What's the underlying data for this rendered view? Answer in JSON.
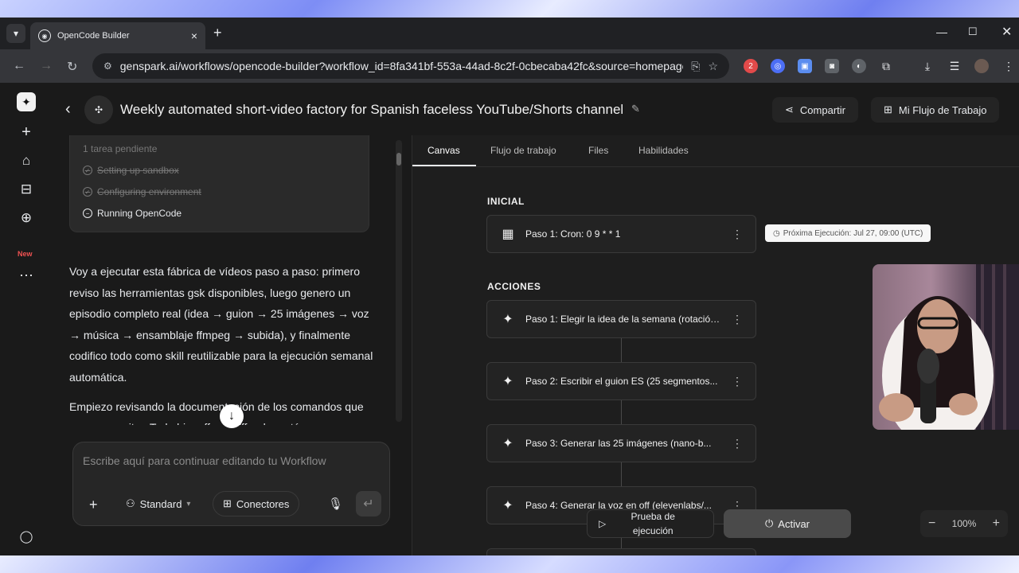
{
  "browser": {
    "tab_title": "OpenCode Builder",
    "url": "genspark.ai/workflows/opencode-builder?workflow_id=8fa341bf-553a-44ad-8c2f-0cbecaba42fc&source=homepage_...",
    "ext_badge": "2"
  },
  "rail": {
    "new_label": "New"
  },
  "header": {
    "title": "Weekly automated short-video factory for Spanish faceless YouTube/Shorts channel",
    "share_label": "Compartir",
    "workflow_label": "Mi Flujo de Trabajo"
  },
  "tasks": {
    "heading": "1 tarea pendiente",
    "items": [
      {
        "label": "Setting up sandbox",
        "status": "done"
      },
      {
        "label": "Configuring environment",
        "status": "done"
      },
      {
        "label": "Running OpenCode",
        "status": "running"
      }
    ]
  },
  "chat": {
    "message": "Voy a ejecutar esta fábrica de vídeos paso a paso: primero reviso las herramientas gsk disponibles, luego genero un episodio completo real (idea → guion → 25 imágenes → voz → música → ensamblaje ffmpeg → subida), y finalmente codifico todo como skill reutilizable para la ejecución semanal automática.",
    "message2": "Empiezo revisando la documentación de los comandos que voy a necesitar. Todo bien, ffmpeg/ffprobe están",
    "composer_placeholder": "Escribe aquí para continuar editando tu Workflow",
    "mode_label": "Standard",
    "connectors_label": "Conectores"
  },
  "canvas": {
    "tabs": [
      "Canvas",
      "Flujo de trabajo",
      "Files",
      "Habilidades"
    ],
    "active_tab": "Canvas",
    "initial_label": "INICIAL",
    "trigger": "Paso 1: Cron: 0 9 * * 1",
    "next_run": "Próxima Ejecución: Jul 27, 09:00 (UTC)",
    "actions_label": "ACCIONES",
    "steps": [
      "Paso 1: Elegir la idea de la semana (rotación...",
      "Paso 2: Escribir el guion ES (25 segmentos...",
      "Paso 3: Generar las 25 imágenes (nano-b...",
      "Paso 4: Generar la voz en off (elevenlabs/..."
    ],
    "test_label": "Prueba de ejecución",
    "activate_label": "Activar",
    "zoom": "100%"
  },
  "colors": {
    "accent_badge": "#e24a4a",
    "ext_blue": "#4c6ef5",
    "background": "#1a1a1a"
  }
}
